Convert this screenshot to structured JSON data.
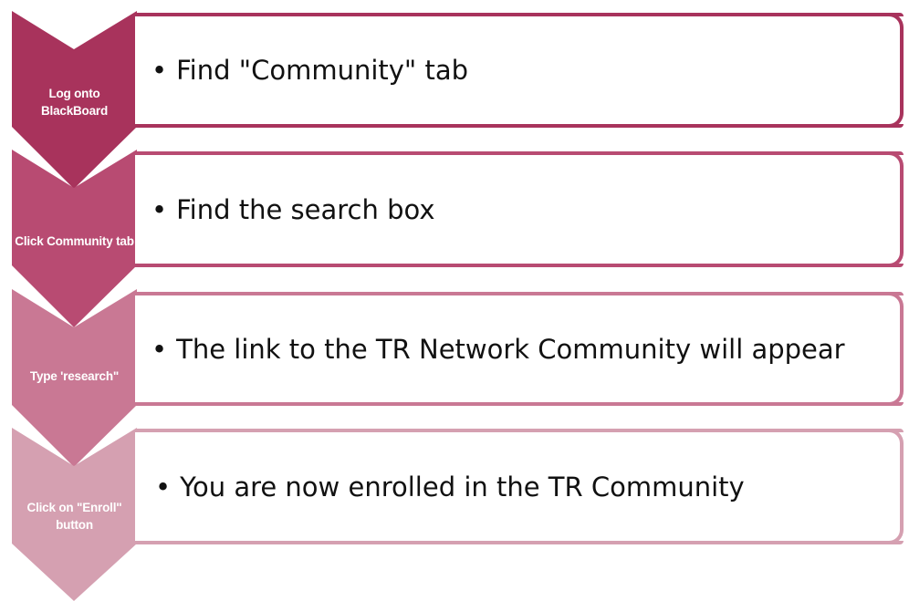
{
  "steps": [
    {
      "chevron_label": "Log onto BlackBoard",
      "text": "Find \"Community\" tab",
      "color": "#a8335c"
    },
    {
      "chevron_label": "Click Community tab",
      "text": "Find the search box",
      "color": "#b84b72"
    },
    {
      "chevron_label": "Type 'research\"",
      "text": "The link to the TR Network Community will appear",
      "color": "#c97894"
    },
    {
      "chevron_label": "Click on \"Enroll\" button",
      "text": "You are now enrolled in the TR Community",
      "color": "#d5a0b1"
    }
  ],
  "bullet_glyph": "•"
}
